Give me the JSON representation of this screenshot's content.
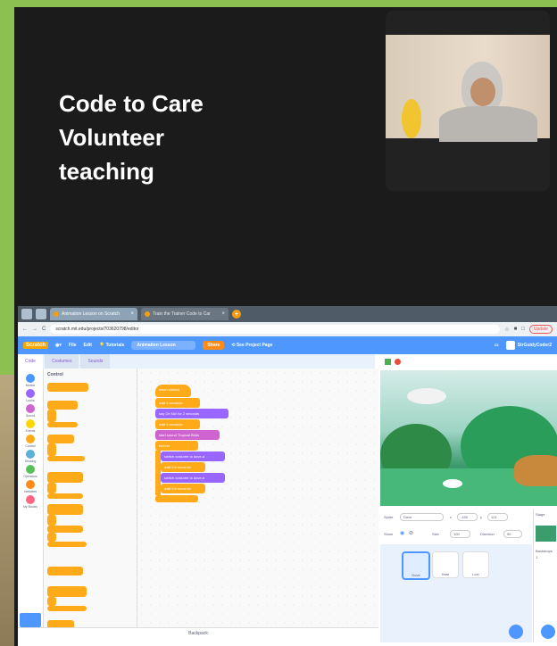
{
  "slide": {
    "title_lines": [
      "Code to Care",
      "Volunteer",
      "teaching"
    ]
  },
  "browser": {
    "tabs": [
      {
        "label": "Animation Lesson on Scratch",
        "close": "×"
      },
      {
        "label": "Train the Trainer Code to Car",
        "close": "×"
      }
    ],
    "new_tab": "+",
    "nav": {
      "back": "←",
      "forward": "→",
      "reload": "C"
    },
    "url": "scratch.mit.edu/projects/703620798/editor",
    "update_label": "Update"
  },
  "scratch": {
    "menu": {
      "logo": "Scratch",
      "file": "File",
      "edit": "Edit",
      "tutorials": "Tutorials",
      "project_title": "Animation Lesson",
      "share": "Share",
      "see_project_page": "See Project Page",
      "username": "StrGuidyCoder2"
    },
    "editor_tabs": {
      "code": "Code",
      "costumes": "Costumes",
      "sounds": "Sounds"
    },
    "categories": [
      {
        "label": "Motion",
        "color": "#4c97ff"
      },
      {
        "label": "Looks",
        "color": "#9966ff"
      },
      {
        "label": "Sound",
        "color": "#cf63cf"
      },
      {
        "label": "Events",
        "color": "#ffd500"
      },
      {
        "label": "Control",
        "color": "#ffab19"
      },
      {
        "label": "Sensing",
        "color": "#5cb1d6"
      },
      {
        "label": "Operators",
        "color": "#59c059"
      },
      {
        "label": "Variables",
        "color": "#ff8c1a"
      },
      {
        "label": "My Blocks",
        "color": "#ff6680"
      }
    ],
    "palette_title": "Control",
    "palette_blocks": {
      "wait": "wait 1 seconds",
      "repeat": "repeat 10",
      "forever": "forever",
      "if_then": "if then",
      "if_else": "else",
      "wait_until": "wait until",
      "repeat_until": "repeat until",
      "stop": "stop all"
    },
    "script": {
      "when_flag": "when clicked",
      "wait1": "wait 1 seconds",
      "say": "say Oh No! for 2 seconds",
      "wait2": "wait 1 seconds",
      "start_sound": "start sound Tropical Birds",
      "forever": "forever",
      "switch1": "switch costume to dove-a",
      "wait3": "wait 0.5 seconds",
      "switch2": "switch costume to dove-b",
      "wait4": "wait 0.5 seconds"
    },
    "zoom": {
      "in": "+",
      "out": "−",
      "reset": "="
    },
    "backpack": "Backpack",
    "sprite_info": {
      "sprite_label": "Sprite",
      "sprite_name": "Dove",
      "x_label": "x",
      "x_value": "-150",
      "y_label": "y",
      "y_value": "113",
      "show_label": "Show",
      "size_label": "Size",
      "size_value": "100",
      "direction_label": "Direction",
      "direction_value": "90"
    },
    "sprites": [
      "Dove",
      "Hare",
      "Lion"
    ],
    "stage_panel": {
      "title": "Stage",
      "backdrops": "Backdrops",
      "count": "1"
    }
  }
}
